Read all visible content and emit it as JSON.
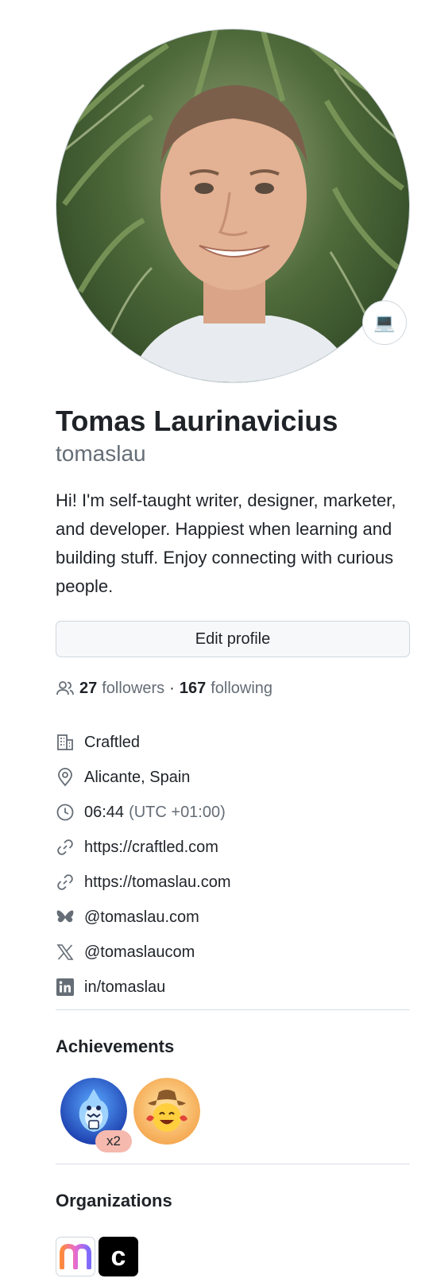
{
  "profile": {
    "name": "Tomas Laurinavicius",
    "login": "tomaslau",
    "status_emoji": "💻",
    "bio": "Hi! I'm self-taught writer, designer, marketer, and developer. Happiest when learning and building stuff. Enjoy connecting with curious people.",
    "edit_label": "Edit profile"
  },
  "follow": {
    "followers_count": "27",
    "followers_label": "followers",
    "separator": "·",
    "following_count": "167",
    "following_label": "following"
  },
  "details": {
    "company": "Craftled",
    "location": "Alicante, Spain",
    "time": "06:44",
    "timezone": "(UTC +01:00)",
    "website_1": "https://craftled.com",
    "website_2": "https://tomaslau.com",
    "bluesky": "@tomaslau.com",
    "x": "@tomaslaucom",
    "linkedin": "in/tomaslau"
  },
  "achievements": {
    "title": "Achievements",
    "items": [
      {
        "icon": "shark-achievement-icon",
        "count": "x2"
      },
      {
        "icon": "cowboy-achievement-icon"
      }
    ]
  },
  "organizations": {
    "title": "Organizations",
    "items": [
      {
        "icon": "m-org-icon",
        "glyph": "m"
      },
      {
        "icon": "c-org-icon",
        "glyph": "c"
      }
    ]
  },
  "colors": {
    "text": "#1f2328",
    "muted": "#656d76",
    "border": "#d0d7de",
    "button_bg": "#f6f8fa",
    "badge_bg": "#f5b9ae"
  }
}
